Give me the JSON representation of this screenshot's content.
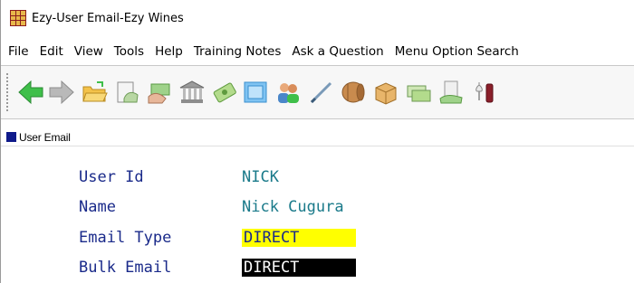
{
  "window": {
    "title": "Ezy-User Email-Ezy Wines"
  },
  "menubar": {
    "items": [
      {
        "label": "File"
      },
      {
        "label": "Edit"
      },
      {
        "label": "View"
      },
      {
        "label": "Tools"
      },
      {
        "label": "Help"
      },
      {
        "label": "Training Notes"
      },
      {
        "label": "Ask a Question"
      },
      {
        "label": "Menu Option Search"
      }
    ]
  },
  "toolbar": {
    "icons": [
      "back-arrow-icon",
      "forward-arrow-icon",
      "open-folder-icon",
      "invoice-icon",
      "payment-icon",
      "bank-icon",
      "cash-icon",
      "postcard-icon",
      "users-icon",
      "pen-icon",
      "barrel-icon",
      "package-icon",
      "money-icon",
      "receipt-icon",
      "wine-bottle-icon"
    ]
  },
  "section": {
    "label": "User Email"
  },
  "form": {
    "user_id": {
      "label": "User Id",
      "value": "NICK"
    },
    "name": {
      "label": "Name",
      "value": "Nick Cugura"
    },
    "email_type": {
      "label": "Email Type",
      "value": "DIRECT"
    },
    "bulk_email": {
      "label": "Bulk Email",
      "value": "DIRECT"
    }
  },
  "colors": {
    "label_text": "#1a2a8a",
    "value_text": "#1a7a8a",
    "email_type_highlight": "#ffff00",
    "bulk_email_highlight": "#000000",
    "section_swatch": "#0f1a8a"
  }
}
